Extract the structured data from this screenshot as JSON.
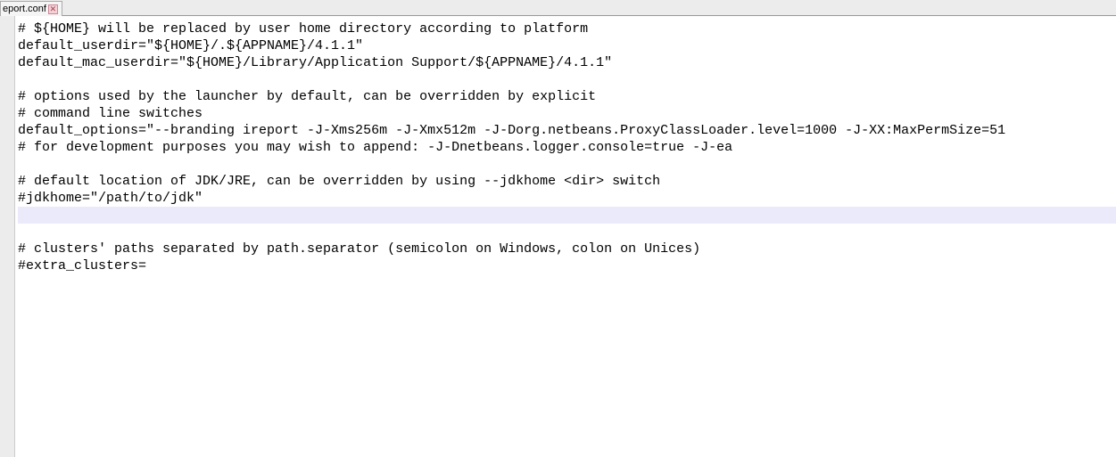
{
  "tab": {
    "label": "eport.conf",
    "close_title": "Close"
  },
  "editor": {
    "lines": [
      "# ${HOME} will be replaced by user home directory according to platform",
      "default_userdir=\"${HOME}/.${APPNAME}/4.1.1\"",
      "default_mac_userdir=\"${HOME}/Library/Application Support/${APPNAME}/4.1.1\"",
      "",
      "# options used by the launcher by default, can be overridden by explicit",
      "# command line switches",
      "default_options=\"--branding ireport -J-Xms256m -J-Xmx512m -J-Dorg.netbeans.ProxyClassLoader.level=1000 -J-XX:MaxPermSize=51",
      "# for development purposes you may wish to append: -J-Dnetbeans.logger.console=true -J-ea",
      "",
      "# default location of JDK/JRE, can be overridden by using --jdkhome <dir> switch",
      "#jdkhome=\"/path/to/jdk\"",
      "",
      "",
      "# clusters' paths separated by path.separator (semicolon on Windows, colon on Unices)",
      "#extra_clusters="
    ],
    "highlight_index": 11
  }
}
